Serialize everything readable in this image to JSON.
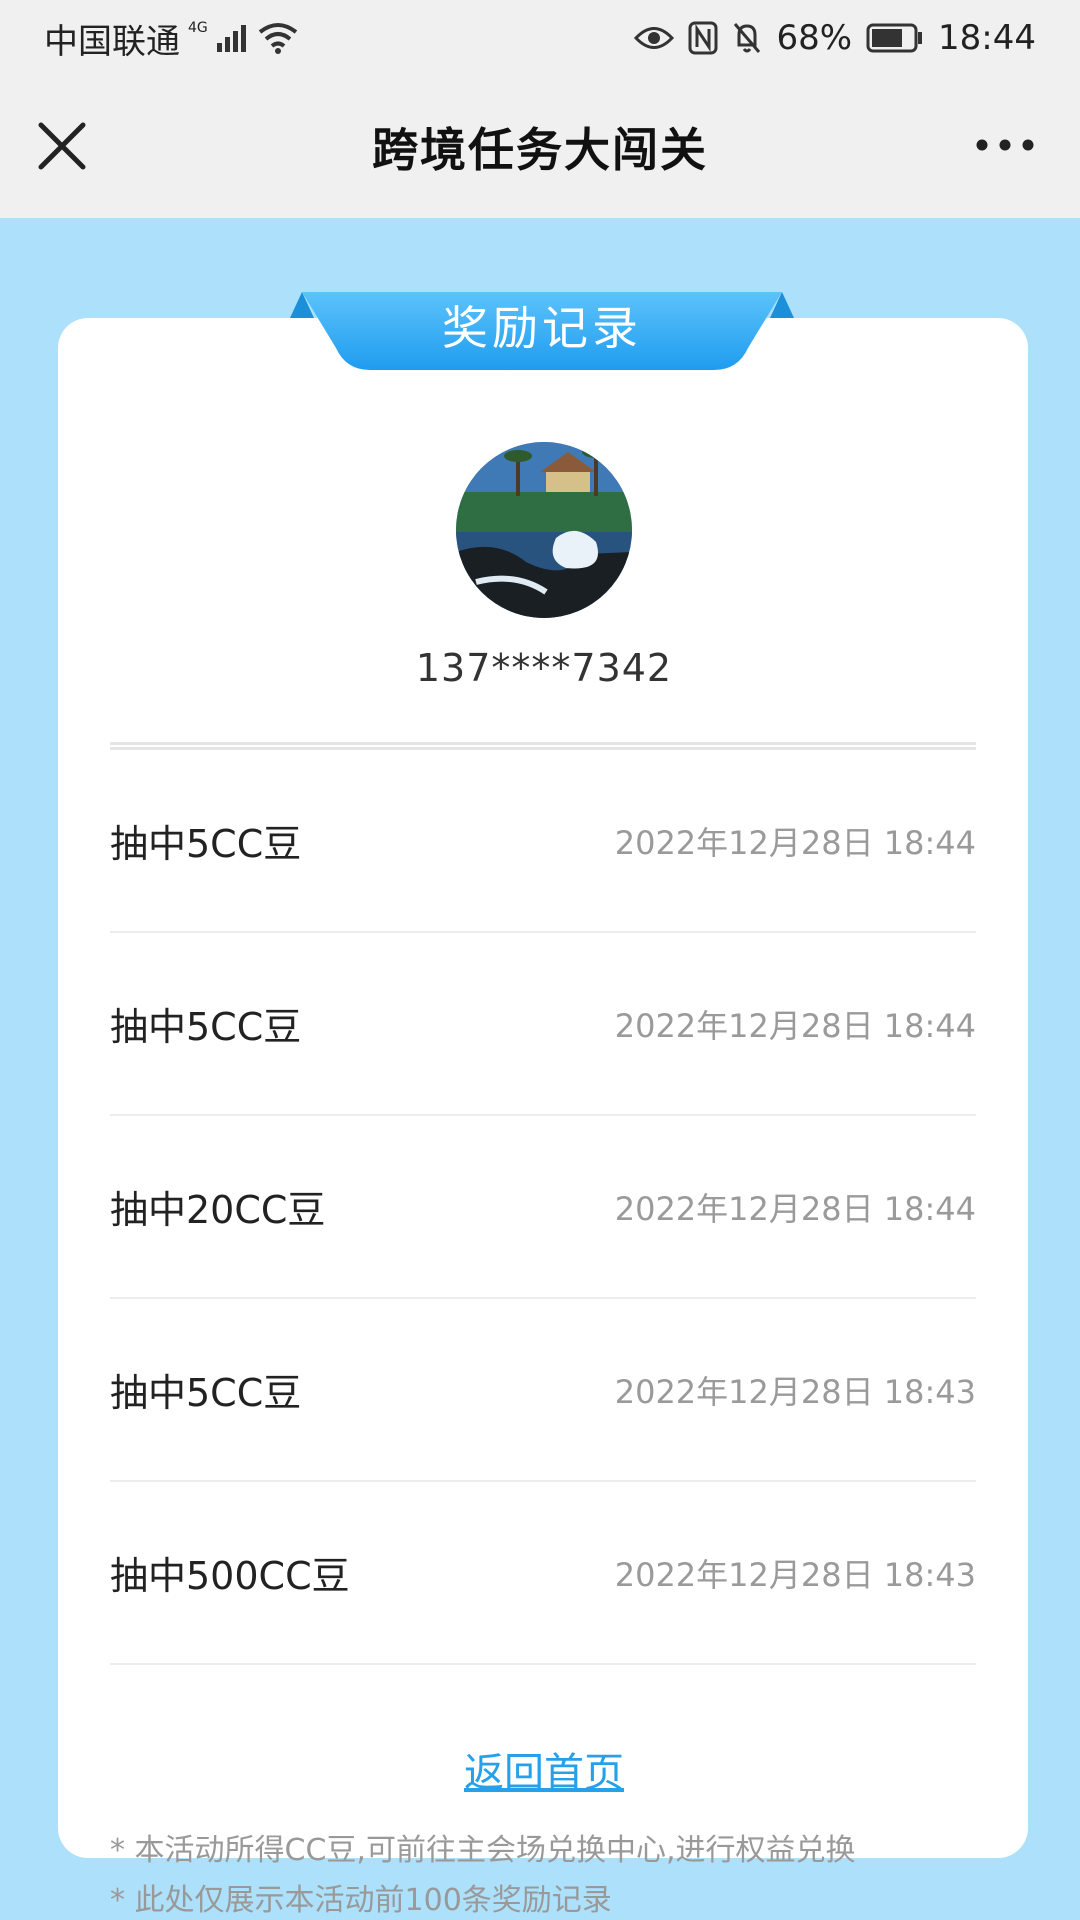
{
  "status_bar": {
    "carrier": "中国联通",
    "network": "4G",
    "battery": "68%",
    "time": "18:44",
    "icons": [
      "signal-icon",
      "wifi-icon",
      "eye-icon",
      "nfc-icon",
      "bell-off-icon",
      "battery-icon"
    ]
  },
  "nav": {
    "title": "跨境任务大闯关",
    "close_icon": "close-icon",
    "more_icon": "more-icon"
  },
  "card": {
    "ribbon_title": "奖励记录",
    "phone": "137****7342",
    "records": [
      {
        "name": "抽中5CC豆",
        "time": "2022年12月28日 18:44"
      },
      {
        "name": "抽中5CC豆",
        "time": "2022年12月28日 18:44"
      },
      {
        "name": "抽中20CC豆",
        "time": "2022年12月28日 18:44"
      },
      {
        "name": "抽中5CC豆",
        "time": "2022年12月28日 18:43"
      },
      {
        "name": "抽中500CC豆",
        "time": "2022年12月28日 18:43"
      }
    ],
    "home_link": "返回首页"
  },
  "notes": [
    "* 本活动所得CC豆,可前往主会场兑换中心,进行权益兑换",
    "* 此处仅展示本活动前100条奖励记录"
  ],
  "colors": {
    "page_bg": "#ace0fb",
    "ribbon": "#2aa8f2",
    "link": "#27a0ea"
  }
}
